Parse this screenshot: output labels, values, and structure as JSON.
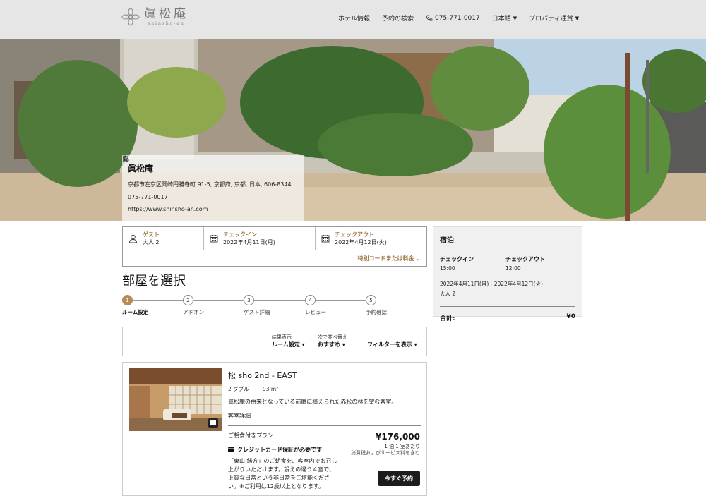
{
  "header": {
    "logo_jp": "眞松庵",
    "logo_en": "shinsho-an",
    "nav": {
      "hotel_info": "ホテル情報",
      "booking_search": "予約の検索",
      "phone": "075-771-0017",
      "language": "日本語",
      "currency": "プロパティ通貨"
    }
  },
  "hotel": {
    "name": "眞松庵",
    "address": "京都市左京区岡崎円勝寺町 91-5, 京都府, 京都, 日本, 606-8344",
    "phone": "075-771-0017",
    "website": "https://www.shinsho-an.com"
  },
  "search": {
    "guest_label": "ゲスト",
    "guest_value": "大人 2",
    "checkin_label": "チェックイン",
    "checkin_value": "2022年4月11日(月)",
    "checkout_label": "チェックアウト",
    "checkout_value": "2022年4月12日(火)",
    "promo_label": "特別コードまたは料金"
  },
  "page_title": "部屋を選択",
  "steps": [
    {
      "num": "1",
      "label": "ルーム設定"
    },
    {
      "num": "2",
      "label": "アドオン"
    },
    {
      "num": "3",
      "label": "ゲスト詳細"
    },
    {
      "num": "4",
      "label": "レビュー"
    },
    {
      "num": "5",
      "label": "予約確認"
    }
  ],
  "sort": {
    "results_label": "結果表示",
    "results_value": "ルーム設定",
    "sort_label": "次で並べ替え",
    "sort_value": "おすすめ",
    "filter_value": "フィルターを表示"
  },
  "room": {
    "name": "松 sho 2nd - EAST",
    "beds": "2 ダブル",
    "area": "93 m²",
    "description": "眞松庵の由来となっている前庭に植えられた赤松の林を望む客室。",
    "details_link": "客室詳細",
    "plan_name": "ご朝食付きプラン",
    "credit_note": "クレジットカード保証が必要です",
    "plan_desc_lines": [
      "「東山 緒方」のご朝食を、客室内でお召し",
      "上がりいただけます。設えの違う４室で、",
      "上質な日常という非日常をご堪能くださ",
      "い。※ご利用は12歳以上となります。"
    ],
    "price": "¥176,000",
    "per_night": "1 泊 1 室あたり",
    "tax_note": "消費税およびサービス料を含む",
    "book_button": "今すぐ予約"
  },
  "summary": {
    "title": "宿泊",
    "checkin_label": "チェックイン",
    "checkin_time": "15:00",
    "checkout_label": "チェックアウト",
    "checkout_time": "12:00",
    "dates": "2022年4月11日(月) - 2022年4月12日(火)",
    "guests": "大人 2",
    "total_label": "合計:",
    "total_value": "¥0"
  },
  "colors": {
    "accent": "#b88b55",
    "label_gold": "#a07a48",
    "header_bg": "#e6e6e6",
    "button": "#1c1c1c"
  }
}
